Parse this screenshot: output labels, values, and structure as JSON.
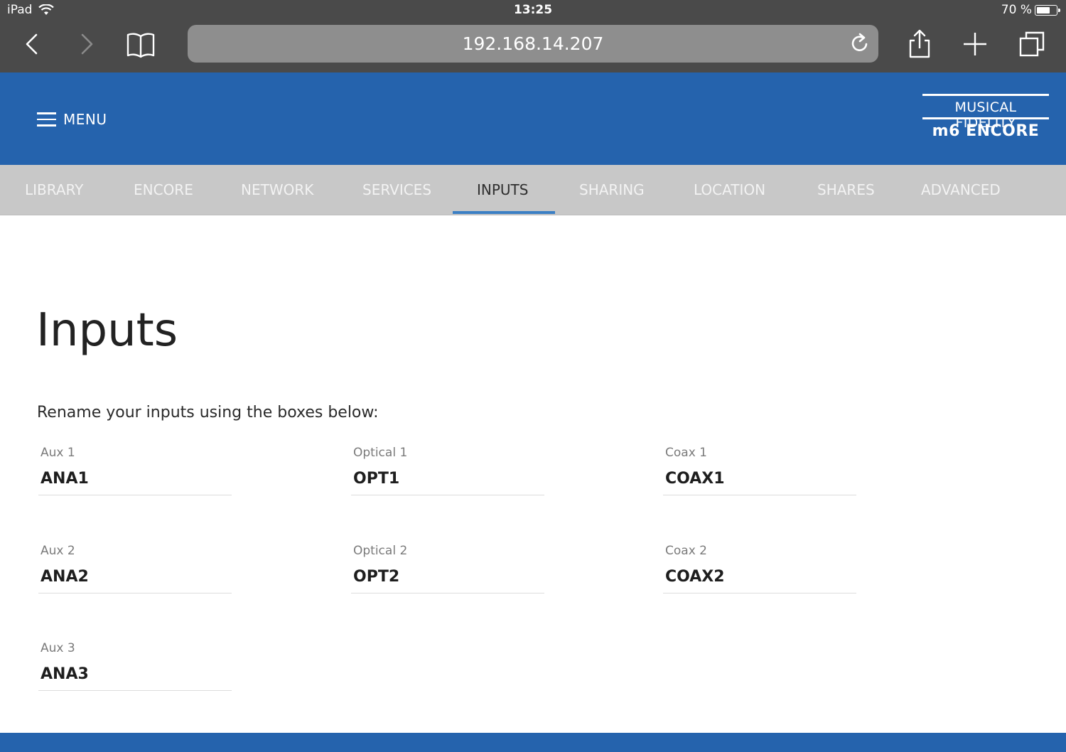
{
  "status_bar": {
    "device": "iPad",
    "time": "13:25",
    "battery_text": "70 %",
    "battery_level": 0.7
  },
  "browser": {
    "url": "192.168.14.207",
    "icons": [
      "back-icon",
      "forward-icon",
      "bookmarks-icon",
      "reload-icon",
      "share-icon",
      "new-tab-icon",
      "tabs-icon"
    ]
  },
  "header": {
    "menu_label": "MENU",
    "logo_line1": "MUSICAL FIDELITY",
    "logo_line2": "m6 ENCORE"
  },
  "nav": {
    "tabs": [
      {
        "label": "LIBRARY"
      },
      {
        "label": "ENCORE"
      },
      {
        "label": "NETWORK"
      },
      {
        "label": "SERVICES"
      },
      {
        "label": "INPUTS"
      },
      {
        "label": "SHARING"
      },
      {
        "label": "LOCATION"
      },
      {
        "label": "SHARES"
      },
      {
        "label": "ADVANCED"
      }
    ],
    "active": "INPUTS"
  },
  "main": {
    "title": "Inputs",
    "subtitle": "Rename your inputs using the boxes below:",
    "fields": [
      {
        "label": "Aux 1",
        "value": "ANA1"
      },
      {
        "label": "Optical 1",
        "value": "OPT1"
      },
      {
        "label": "Coax 1",
        "value": "COAX1"
      },
      {
        "label": "Aux 2",
        "value": "ANA2"
      },
      {
        "label": "Optical 2",
        "value": "OPT2"
      },
      {
        "label": "Coax 2",
        "value": "COAX2"
      },
      {
        "label": "Aux 3",
        "value": "ANA3"
      }
    ]
  },
  "colors": {
    "brand_blue": "#2563ad",
    "active_tab_underline": "#3b7fc4",
    "nav_bg": "#c8c8c8",
    "chrome_bg": "#4a4a4a"
  }
}
